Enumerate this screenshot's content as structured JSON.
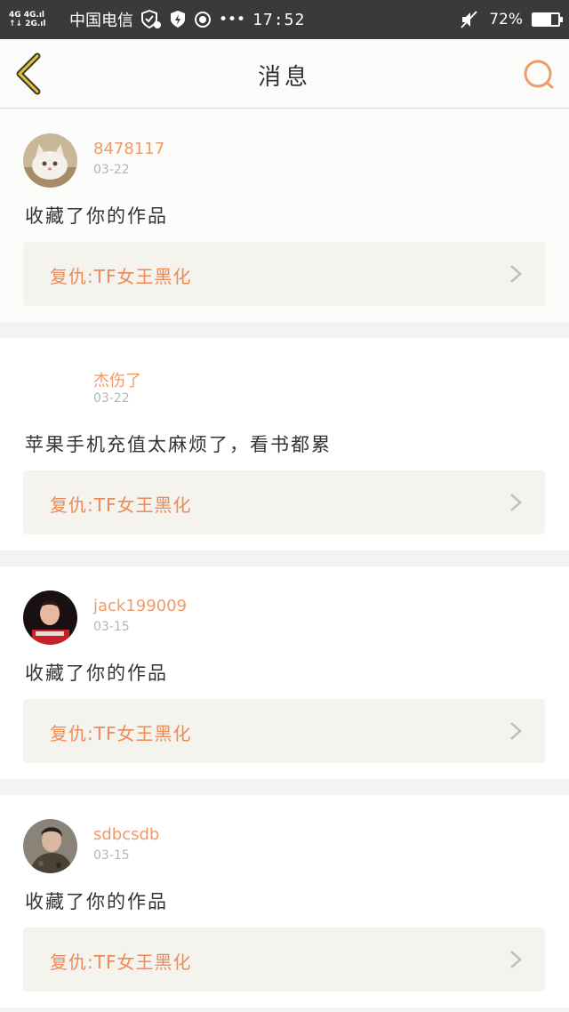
{
  "statusbar": {
    "network_top": "4G 4G.ıl",
    "network_bottom": "↑↓ 2G.ıl",
    "carrier": "中国电信",
    "time": "17:52",
    "battery": "72%",
    "battery_level": 0.72,
    "dots": "•••"
  },
  "nav": {
    "title": "消息"
  },
  "messages": [
    {
      "username": "8478117",
      "date": "03-22",
      "text": "收藏了你的作品",
      "ref": "复仇:TF女王黑化",
      "avatar": "cat-avatar"
    },
    {
      "username": "杰伤了",
      "date": "03-22",
      "text": "苹果手机充值太麻烦了，看书都累",
      "ref": "复仇:TF女王黑化",
      "avatar": "none"
    },
    {
      "username": "jack199009",
      "date": "03-15",
      "text": "收藏了你的作品",
      "ref": "复仇:TF女王黑化",
      "avatar": "person-avatar"
    },
    {
      "username": "sdbcsdb",
      "date": "03-15",
      "text": "收藏了你的作品",
      "ref": "复仇:TF女王黑化",
      "avatar": "person-avatar"
    }
  ],
  "colors": {
    "accent": "#ef9a68",
    "back_icon": "#c9a227",
    "search_icon": "#ef9a68"
  }
}
